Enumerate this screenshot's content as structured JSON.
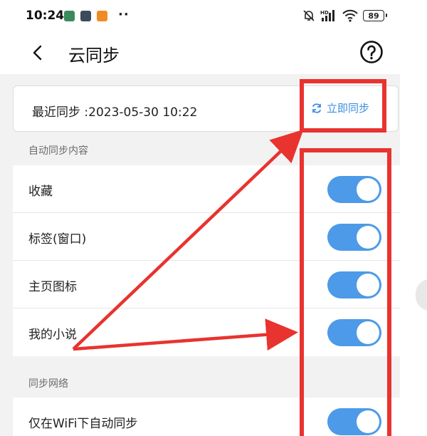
{
  "status_bar": {
    "time": "10:24",
    "more": "··",
    "network_badge": "HD",
    "battery": "89"
  },
  "header": {
    "title": "云同步",
    "back_icon": "chevron-left-icon",
    "help_icon": "help-circle-icon"
  },
  "sync": {
    "last_sync": "最近同步 :2023-05-30 10:22",
    "sync_now_label": "立即同步",
    "sync_icon": "refresh-icon",
    "accent_color": "#3a8ee0"
  },
  "auto_sync": {
    "section_title": "自动同步内容",
    "items": [
      {
        "label": "收藏",
        "enabled": true
      },
      {
        "label": "标签(窗口)",
        "enabled": true
      },
      {
        "label": "主页图标",
        "enabled": true
      },
      {
        "label": "我的小说",
        "enabled": true
      }
    ]
  },
  "network": {
    "section_title": "同步网络",
    "items": [
      {
        "label": "仅在WiFi下自动同步",
        "enabled": true
      }
    ]
  },
  "colors": {
    "toggle_on": "#4c9ae8",
    "annotation_red": "#e8332f"
  }
}
